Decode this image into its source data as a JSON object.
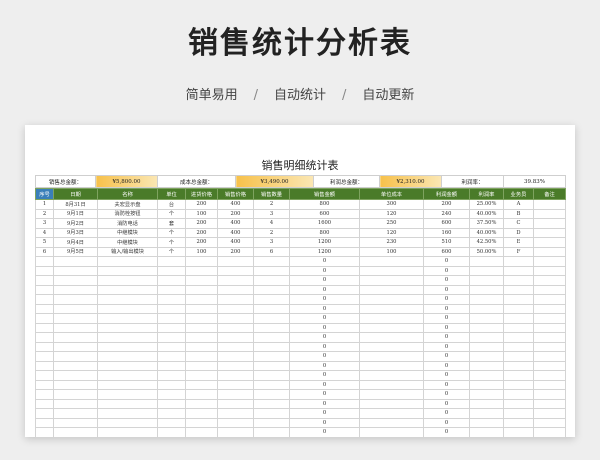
{
  "banner": {
    "title": "销售统计分析表",
    "features": [
      "简单易用",
      "自动统计",
      "自动更新"
    ],
    "separator": "/"
  },
  "sheet": {
    "title": "销售明细统计表",
    "summary": [
      {
        "label": "销售总金额：",
        "value": "¥5,800.00",
        "highlight": true
      },
      {
        "label": "成本总金额：",
        "value": "¥3,490.00",
        "highlight": true
      },
      {
        "label": "利润总金额：",
        "value": "¥2,310.00",
        "highlight": true
      },
      {
        "label": "利润率：",
        "value": "39.83%",
        "highlight": false
      }
    ],
    "columns": [
      "序号",
      "日期",
      "名称",
      "单位",
      "进货价格",
      "销售价格",
      "销售数量",
      "销售金额",
      "单位成本",
      "利润金额",
      "利润率",
      "业务员",
      "备注"
    ],
    "rows": [
      [
        "1",
        "8月31日",
        "夫宏显示盘",
        "台",
        "200",
        "400",
        "2",
        "800",
        "300",
        "200",
        "25.00%",
        "A",
        ""
      ],
      [
        "2",
        "9月1日",
        "消防栓按钮",
        "个",
        "100",
        "200",
        "3",
        "600",
        "120",
        "240",
        "40.00%",
        "B",
        ""
      ],
      [
        "3",
        "9月2日",
        "消防电话",
        "套",
        "200",
        "400",
        "4",
        "1600",
        "250",
        "600",
        "37.50%",
        "C",
        ""
      ],
      [
        "4",
        "9月3日",
        "中继模块",
        "个",
        "200",
        "400",
        "2",
        "800",
        "120",
        "160",
        "40.00%",
        "D",
        ""
      ],
      [
        "5",
        "9月4日",
        "中继模块",
        "个",
        "200",
        "400",
        "3",
        "1200",
        "230",
        "510",
        "42.50%",
        "E",
        ""
      ],
      [
        "6",
        "9月5日",
        "输入/输出模块",
        "个",
        "100",
        "200",
        "6",
        "1200",
        "100",
        "600",
        "50.00%",
        "F",
        ""
      ],
      [
        "",
        "",
        "",
        "",
        "",
        "",
        "",
        "0",
        "",
        "0",
        "",
        "",
        ""
      ],
      [
        "",
        "",
        "",
        "",
        "",
        "",
        "",
        "0",
        "",
        "0",
        "",
        "",
        ""
      ],
      [
        "",
        "",
        "",
        "",
        "",
        "",
        "",
        "0",
        "",
        "0",
        "",
        "",
        ""
      ],
      [
        "",
        "",
        "",
        "",
        "",
        "",
        "",
        "0",
        "",
        "0",
        "",
        "",
        ""
      ],
      [
        "",
        "",
        "",
        "",
        "",
        "",
        "",
        "0",
        "",
        "0",
        "",
        "",
        ""
      ],
      [
        "",
        "",
        "",
        "",
        "",
        "",
        "",
        "0",
        "",
        "0",
        "",
        "",
        ""
      ],
      [
        "",
        "",
        "",
        "",
        "",
        "",
        "",
        "0",
        "",
        "0",
        "",
        "",
        ""
      ],
      [
        "",
        "",
        "",
        "",
        "",
        "",
        "",
        "0",
        "",
        "0",
        "",
        "",
        ""
      ],
      [
        "",
        "",
        "",
        "",
        "",
        "",
        "",
        "0",
        "",
        "0",
        "",
        "",
        ""
      ],
      [
        "",
        "",
        "",
        "",
        "",
        "",
        "",
        "0",
        "",
        "0",
        "",
        "",
        ""
      ],
      [
        "",
        "",
        "",
        "",
        "",
        "",
        "",
        "0",
        "",
        "0",
        "",
        "",
        ""
      ],
      [
        "",
        "",
        "",
        "",
        "",
        "",
        "",
        "0",
        "",
        "0",
        "",
        "",
        ""
      ],
      [
        "",
        "",
        "",
        "",
        "",
        "",
        "",
        "0",
        "",
        "0",
        "",
        "",
        ""
      ],
      [
        "",
        "",
        "",
        "",
        "",
        "",
        "",
        "0",
        "",
        "0",
        "",
        "",
        ""
      ],
      [
        "",
        "",
        "",
        "",
        "",
        "",
        "",
        "0",
        "",
        "0",
        "",
        "",
        ""
      ],
      [
        "",
        "",
        "",
        "",
        "",
        "",
        "",
        "0",
        "",
        "0",
        "",
        "",
        ""
      ],
      [
        "",
        "",
        "",
        "",
        "",
        "",
        "",
        "0",
        "",
        "0",
        "",
        "",
        ""
      ],
      [
        "",
        "",
        "",
        "",
        "",
        "",
        "",
        "0",
        "",
        "0",
        "",
        "",
        ""
      ],
      [
        "",
        "",
        "",
        "",
        "",
        "",
        "",
        "0",
        "",
        "0",
        "",
        "",
        ""
      ]
    ]
  },
  "colors": {
    "header_bg": "#4a7b29",
    "index_header_bg": "#3a7fb9",
    "highlight_start": "#f7c14b",
    "highlight_end": "#fbe7b4"
  }
}
